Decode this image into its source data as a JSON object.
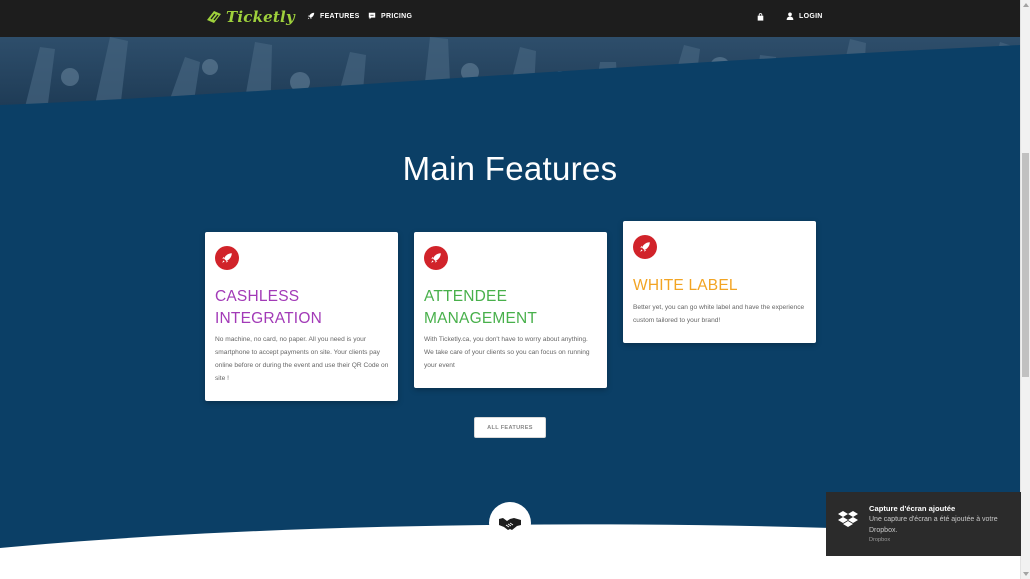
{
  "header": {
    "brand": "Ticketly",
    "nav": {
      "features": "FEATURES",
      "pricing": "PRICING",
      "login": "LOGIN"
    }
  },
  "main": {
    "title": "Main Features",
    "cards": [
      {
        "title_line1": "CASHLESS",
        "title_line2": "INTEGRATION",
        "title_color": "#a23ab7",
        "text": "No machine, no card, no paper. All you need is your smartphone to accept payments on site. Your clients pay online before or during the event and use their QR Code on site !"
      },
      {
        "title_line1": "ATTENDEE",
        "title_line2": "MANAGEMENT",
        "title_color": "#48b04b",
        "text": "With Ticketly.ca, you don't have to worry about anything. We take care of your clients so you can focus on running your event"
      },
      {
        "title_line1": "WHITE LABEL",
        "title_color": "#f2a423",
        "text": "Better yet, you can go white label and have the experience custom tailored to your brand!"
      }
    ],
    "all_features_label": "ALL FEATURES"
  },
  "notification": {
    "title": "Capture d'écran ajoutée",
    "body": "Une capture d'écran a été ajoutée à votre Dropbox.",
    "source": "Dropbox"
  },
  "colors": {
    "navbar": "#1d1d1d",
    "section_bg": "#0b3f66",
    "accent_red": "#d1232a",
    "brand_green": "#9fd13c"
  },
  "icons": {
    "logo": "ticket-logo-icon",
    "features": "rocket-icon",
    "pricing": "chat-bubble-icon",
    "cart": "shopping-bag-icon",
    "login": "user-icon",
    "card": "rocket-icon",
    "bottom": "handshake-icon",
    "notification": "dropbox-icon"
  }
}
